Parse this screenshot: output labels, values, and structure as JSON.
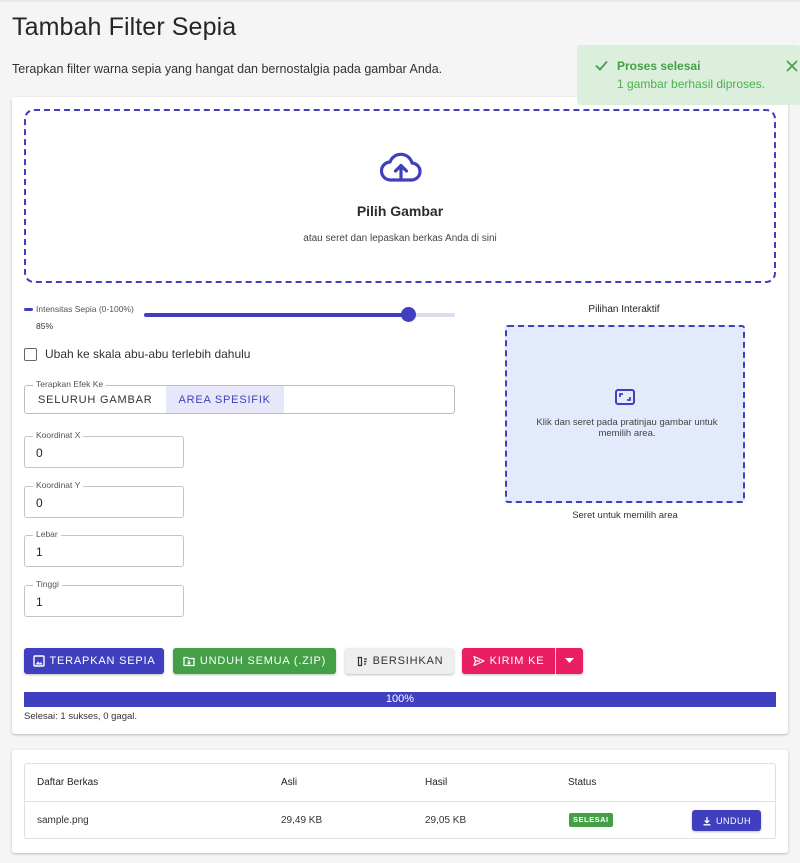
{
  "header": {
    "title": "Tambah Filter Sepia",
    "subtitle": "Terapkan filter warna sepia yang hangat dan bernostalgia pada gambar Anda."
  },
  "toast": {
    "title": "Proses selesai",
    "message": "1 gambar berhasil diproses.",
    "icon": "check-icon",
    "close_icon": "close-icon"
  },
  "dropzone": {
    "icon": "cloud-upload-icon",
    "title": "Pilih Gambar",
    "subtitle": "atau seret dan lepaskan berkas Anda di sini"
  },
  "slider": {
    "label": "Intensitas Sepia (0-100%)",
    "value": 85,
    "value_text": "85%"
  },
  "grayscale_checkbox": {
    "label": "Ubah ke skala abu-abu terlebih dahulu",
    "checked": false
  },
  "apply_to": {
    "legend": "Terapkan Efek Ke",
    "options": [
      "SELURUH GAMBAR",
      "AREA SPESIFIK"
    ],
    "selected": "AREA SPESIFIK"
  },
  "fields": {
    "x": {
      "label": "Koordinat X",
      "value": "0"
    },
    "y": {
      "label": "Koordinat Y",
      "value": "0"
    },
    "width": {
      "label": "Lebar",
      "value": "1"
    },
    "height": {
      "label": "Tinggi",
      "value": "1"
    }
  },
  "interactive": {
    "title": "Pilihan Interaktif",
    "icon": "select-area-icon",
    "instruction": "Klik dan seret pada pratinjau gambar untuk memilih area.",
    "caption": "Seret untuk memilih area"
  },
  "actions": {
    "apply_label": "TERAPKAN SEPIA",
    "download_all_label": "UNDUH SEMUA (.ZIP)",
    "clear_label": "BERSIHKAN",
    "send_label": "KIRIM KE"
  },
  "progress": {
    "percent": 100,
    "percent_text": "100%",
    "status": "Selesai: 1 sukses, 0 gagal."
  },
  "files": {
    "headers": [
      "Daftar Berkas",
      "Asli",
      "Hasil",
      "Status"
    ],
    "rows": [
      {
        "name": "sample.png",
        "original": "29,49 KB",
        "result": "29,05 KB",
        "status": "SELESAI",
        "action": "UNDUH"
      }
    ]
  },
  "colors": {
    "primary": "#3f3fbf",
    "success": "#43a047",
    "accent": "#e91e63",
    "toast_bg": "#dcefdc",
    "selection_bg": "#e3eafc"
  }
}
